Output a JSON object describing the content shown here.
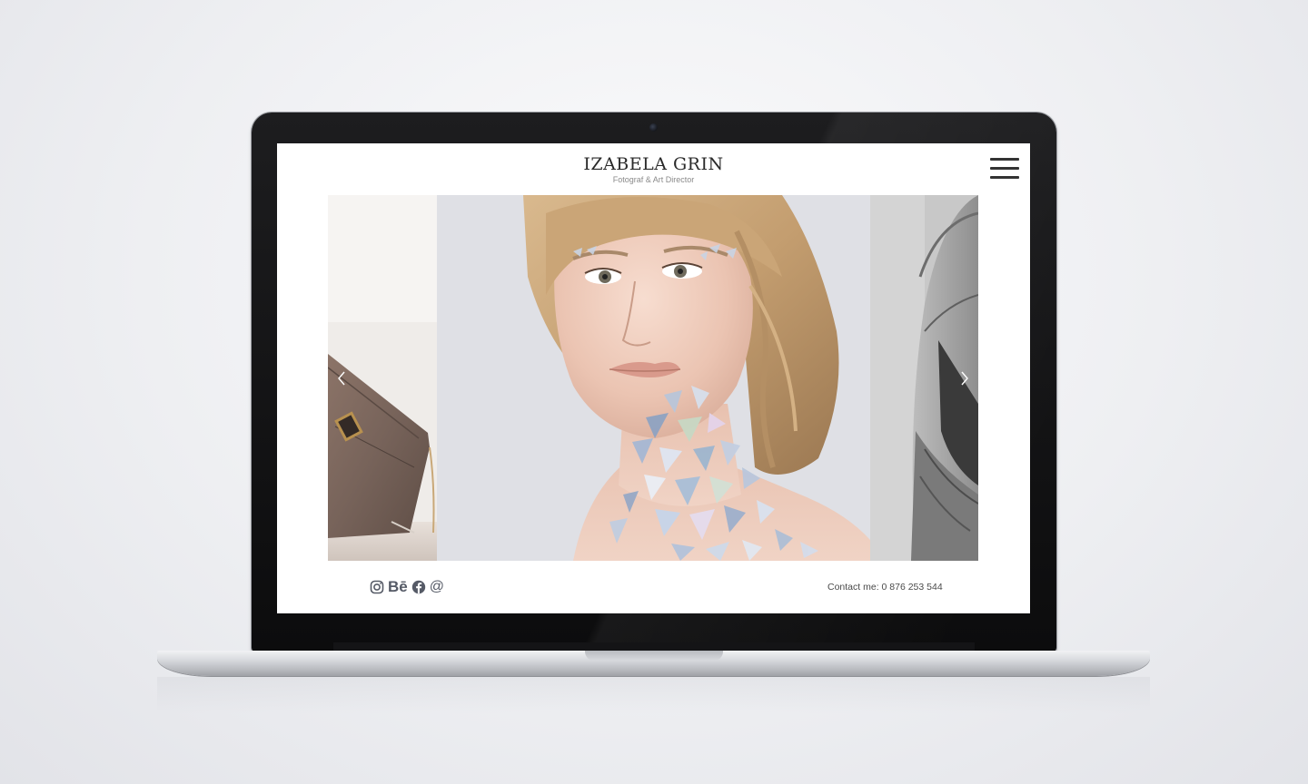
{
  "site": {
    "brand_name": "IZABELA GRIN",
    "tagline": "Fotograf & Art Director",
    "contact": "Contact me: 0 876 253 544"
  },
  "social": {
    "behance_label": "Bē",
    "email_label": "@"
  },
  "carousel": {
    "slides": [
      {
        "subject": "handbag product photo"
      },
      {
        "subject": "portrait with holographic glitter makeup"
      },
      {
        "subject": "black-and-white portrait with scarf"
      }
    ]
  },
  "colors": {
    "background": "#eeeff2",
    "laptop_bezel": "#111112",
    "text": "#2a2a2a",
    "icon": "#555a66"
  }
}
